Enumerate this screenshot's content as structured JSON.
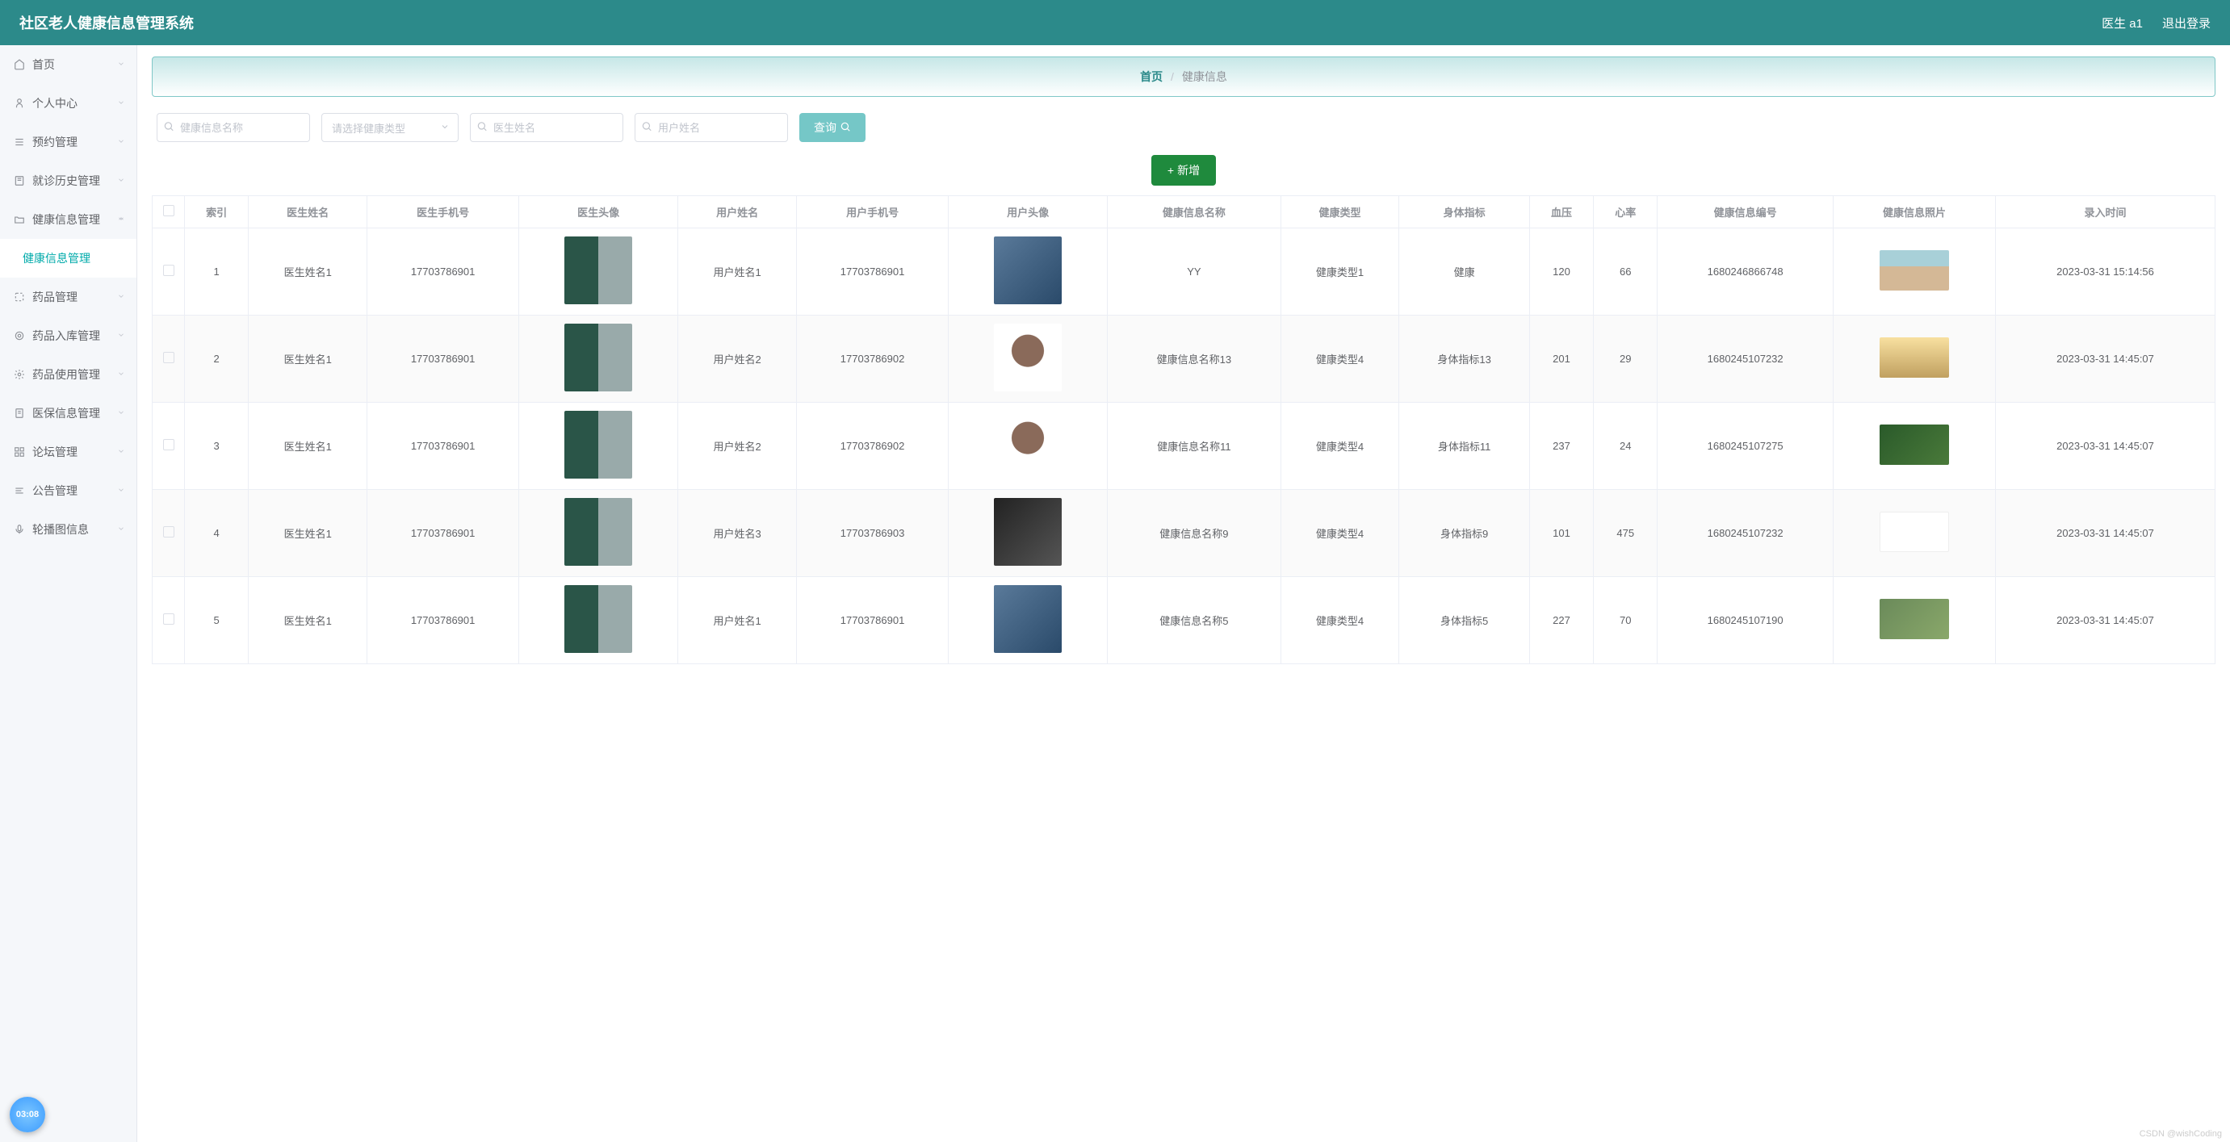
{
  "header": {
    "title": "社区老人健康信息管理系统",
    "user": "医生 a1",
    "logout": "退出登录"
  },
  "sidebar": {
    "items": [
      {
        "label": "首页",
        "icon": "home"
      },
      {
        "label": "个人中心",
        "icon": "user"
      },
      {
        "label": "预约管理",
        "icon": "list"
      },
      {
        "label": "就诊历史管理",
        "icon": "book"
      },
      {
        "label": "健康信息管理",
        "icon": "folder",
        "expanded": true
      },
      {
        "label": "健康信息管理",
        "sub": true,
        "active": true
      },
      {
        "label": "药品管理",
        "icon": "scan"
      },
      {
        "label": "药品入库管理",
        "icon": "target"
      },
      {
        "label": "药品使用管理",
        "icon": "gear"
      },
      {
        "label": "医保信息管理",
        "icon": "doc"
      },
      {
        "label": "论坛管理",
        "icon": "grid"
      },
      {
        "label": "公告管理",
        "icon": "note"
      },
      {
        "label": "轮播图信息",
        "icon": "mic"
      }
    ]
  },
  "breadcrumb": {
    "home": "首页",
    "sep": "/",
    "current": "健康信息"
  },
  "toolbar": {
    "name_placeholder": "健康信息名称",
    "type_placeholder": "请选择健康类型",
    "doctor_placeholder": "医生姓名",
    "user_placeholder": "用户姓名",
    "query": "查询",
    "add": "新增"
  },
  "table": {
    "headers": [
      "索引",
      "医生姓名",
      "医生手机号",
      "医生头像",
      "用户姓名",
      "用户手机号",
      "用户头像",
      "健康信息名称",
      "健康类型",
      "身体指标",
      "血压",
      "心率",
      "健康信息编号",
      "健康信息照片",
      "录入时间"
    ],
    "rows": [
      {
        "idx": "1",
        "doctor": "医生姓名1",
        "dphone": "177037869​01",
        "user": "用户姓名1",
        "uphone": "177037869​01",
        "hname": "YY",
        "htype": "健康类型1",
        "metric": "健康",
        "bp": "120",
        "hr": "66",
        "hid": "1680246866748",
        "time": "2023-03-31 15:14:56",
        "uav": "av-user-1",
        "ph": "ph-1"
      },
      {
        "idx": "2",
        "doctor": "医生姓名1",
        "dphone": "177037869​01",
        "user": "用户姓名2",
        "uphone": "177037869​02",
        "hname": "健康信息名称13",
        "htype": "健康类型4",
        "metric": "身体指标13",
        "bp": "201",
        "hr": "29",
        "hid": "1680245107232",
        "time": "2023-03-31 14:45:07",
        "uav": "av-user-2",
        "ph": "ph-2"
      },
      {
        "idx": "3",
        "doctor": "医生姓名1",
        "dphone": "177037869​01",
        "user": "用户姓名2",
        "uphone": "177037869​02",
        "hname": "健康信息名称11",
        "htype": "健康类型4",
        "metric": "身体指标11",
        "bp": "237",
        "hr": "24",
        "hid": "1680245107275",
        "time": "2023-03-31 14:45:07",
        "uav": "av-user-2",
        "ph": "ph-3"
      },
      {
        "idx": "4",
        "doctor": "医生姓名1",
        "dphone": "177037869​01",
        "user": "用户姓名3",
        "uphone": "177037869​03",
        "hname": "健康信息名称9",
        "htype": "健康类型4",
        "metric": "身体指标9",
        "bp": "101",
        "hr": "475",
        "hid": "1680245107232",
        "time": "2023-03-31 14:45:07",
        "uav": "av-user-4",
        "ph": "ph-4"
      },
      {
        "idx": "5",
        "doctor": "医生姓名1",
        "dphone": "177037869​01",
        "user": "用户姓名1",
        "uphone": "177037869​01",
        "hname": "健康信息名称5",
        "htype": "健康类型4",
        "metric": "身体指标5",
        "bp": "227",
        "hr": "70",
        "hid": "1680245107190",
        "time": "2023-03-31 14:45:07",
        "uav": "av-user-1",
        "ph": "ph-5"
      }
    ]
  },
  "timer": "03:08",
  "watermark": "CSDN @wishCoding"
}
